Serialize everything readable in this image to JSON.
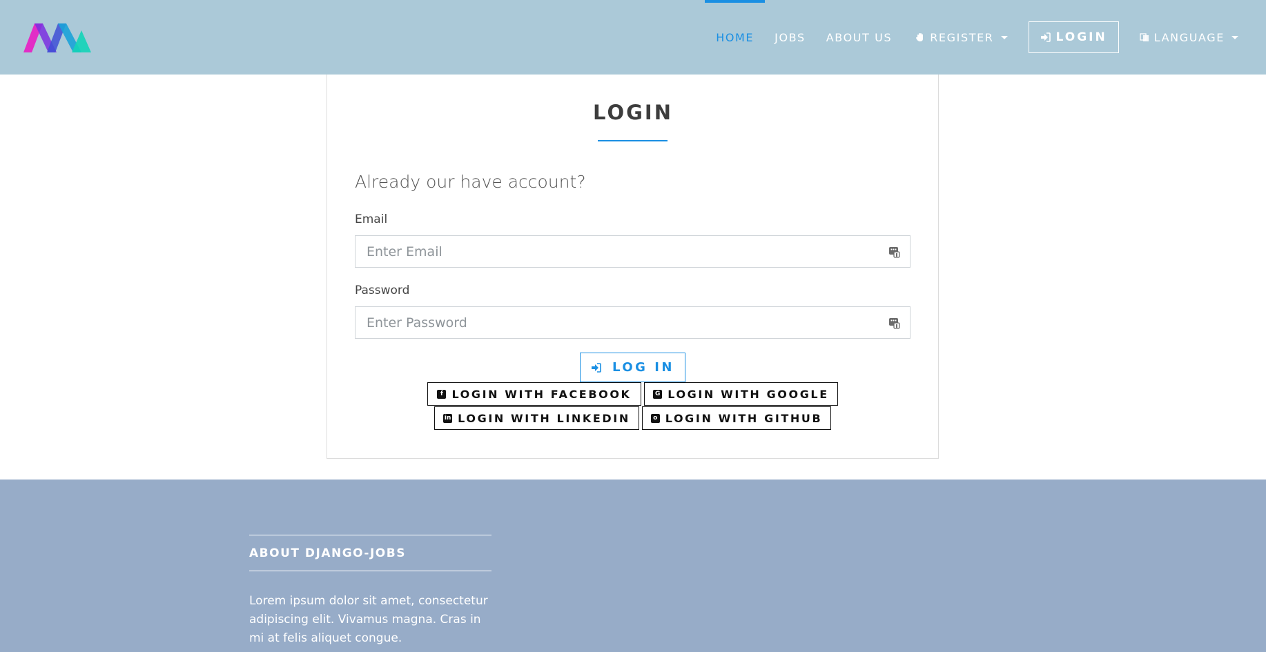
{
  "navbar": {
    "logo_icon": "brand-logo-m",
    "items": [
      {
        "label": "HOME",
        "active": true
      },
      {
        "label": "JOBS",
        "active": false
      },
      {
        "label": "ABOUT US",
        "active": false
      }
    ],
    "register_label": "REGISTER",
    "register_icon": "hand-icon",
    "login_label": "LOGIN",
    "login_icon": "sign-in-icon",
    "language_label": "LANGUAGE",
    "language_icon": "language-icon"
  },
  "login_card": {
    "title": "LOGIN",
    "subtitle": "Already our have account?",
    "email_label": "Email",
    "email_placeholder": "Enter Email",
    "email_value": "",
    "password_label": "Password",
    "password_placeholder": "Enter Password",
    "password_value": "",
    "submit_label": "LOG IN",
    "social": {
      "facebook": "LOGIN WITH FACEBOOK",
      "google": "LOGIN WITH GOOGLE",
      "linkedin": "LOGIN WITH LINKEDIN",
      "github": "LOGIN WITH GITHUB"
    }
  },
  "footer": {
    "heading": "ABOUT DJANGO-JOBS",
    "text": "Lorem ipsum dolor sit amet, consectetur adipiscing elit. Vivamus magna. Cras in mi at felis aliquet congue."
  },
  "colors": {
    "navbar_bg": "#abc9d8",
    "accent": "#1a8fe3",
    "footer_bg": "#97acc8"
  }
}
